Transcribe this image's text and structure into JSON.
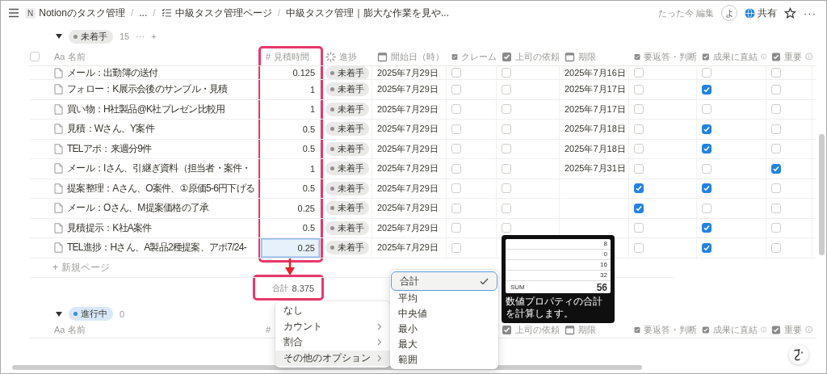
{
  "breadcrumb": [
    {
      "kind": "workspace",
      "glyph": "N",
      "label": "Notionのタスク管理"
    },
    {
      "kind": "ellipsis",
      "separator": "/",
      "label": "..."
    },
    {
      "kind": "list",
      "separator": "/",
      "label": "中級タスク管理ページ"
    },
    {
      "kind": "page",
      "separator": "/",
      "label": "中級タスク管理｜膨大な作業を見や..."
    }
  ],
  "topbar": {
    "edited": "たった今 編集",
    "avatar": "よ",
    "share": "共有",
    "more": "···"
  },
  "groups": [
    {
      "label": "未着手",
      "color": "#91918e",
      "count": "15",
      "more": "···",
      "add": "+",
      "expanded": true,
      "select_all_checked": false,
      "columns": [
        {
          "kind": "title",
          "glyph": "Aa",
          "label": "名前"
        },
        {
          "kind": "number",
          "glyph": "#",
          "label": "見積時間"
        },
        {
          "kind": "status",
          "label": "進捗"
        },
        {
          "kind": "date",
          "label": "開始日（時）"
        },
        {
          "kind": "checkbox",
          "label": "クレーム"
        },
        {
          "kind": "checkbox",
          "label": "上司の依頼"
        },
        {
          "kind": "date",
          "label": "期限"
        },
        {
          "kind": "checkbox",
          "label": "要返答・判断"
        },
        {
          "kind": "checkbox",
          "label": "成果に直結",
          "info": true
        },
        {
          "kind": "checkbox",
          "label": "重要",
          "info": true
        }
      ],
      "rows": [
        {
          "estimate_selected": false,
          "cells": [
            "メール：出勤簿の送付",
            "0.125",
            "未着手",
            "2025年7月29日",
            false,
            false,
            "2025年7月16日",
            false,
            false,
            false
          ]
        },
        {
          "estimate_selected": false,
          "cells": [
            "フォロー：K展示会後のサンプル・見積",
            "1",
            "未着手",
            "2025年7月29日",
            false,
            false,
            "2025年7月17日",
            false,
            true,
            false
          ]
        },
        {
          "estimate_selected": false,
          "cells": [
            "買い物：H社製品@K社プレゼン比較用",
            "1",
            "未着手",
            "2025年7月29日",
            false,
            false,
            "2025年7月17日",
            false,
            false,
            false
          ]
        },
        {
          "estimate_selected": false,
          "cells": [
            "見積：Wさん、Y案件",
            "0.5",
            "未着手",
            "2025年7月29日",
            false,
            false,
            "2025年7月18日",
            false,
            true,
            false
          ]
        },
        {
          "estimate_selected": false,
          "cells": [
            "TELアポ：来週分9件",
            "0.5",
            "未着手",
            "2025年7月29日",
            false,
            false,
            "2025年7月18日",
            false,
            true,
            false
          ]
        },
        {
          "estimate_selected": false,
          "cells": [
            "メール：Iさん、引継ぎ資料（担当者・案件・",
            "1",
            "未着手",
            "2025年7月29日",
            false,
            false,
            "2025年7月31日",
            false,
            false,
            true
          ]
        },
        {
          "estimate_selected": false,
          "cells": [
            "提案整理：Aさん、O案件、①原価5-6円下げる",
            "0.5",
            "未着手",
            "2025年7月29日",
            false,
            false,
            "",
            true,
            true,
            false
          ]
        },
        {
          "estimate_selected": false,
          "cells": [
            "メール：Oさん、M提案価格の了承",
            "0.25",
            "未着手",
            "2025年7月29日",
            false,
            false,
            "",
            true,
            false,
            false
          ]
        },
        {
          "estimate_selected": false,
          "cells": [
            "見積提示：K社A案件",
            "0.5",
            "未着手",
            "2025年7月29日",
            false,
            false,
            "",
            false,
            true,
            false
          ]
        },
        {
          "estimate_selected": true,
          "cells": [
            "TEL進捗：Hさん、A製品2種提案、アポ7/24-",
            "0.25",
            "未着手",
            "2025年7月29日",
            false,
            null,
            "",
            false,
            true,
            false
          ]
        }
      ],
      "new_page_icon": "+",
      "new_page": "新規ページ",
      "sum": {
        "label": "合計",
        "value": "8.375"
      }
    },
    {
      "label": "進行中",
      "color": "#3a8ed6",
      "count": "0",
      "expanded": true,
      "columns": [
        {
          "kind": "title",
          "glyph": "Aa",
          "label": "名前"
        },
        {
          "kind": "number",
          "glyph": "#"
        },
        {
          "kind": "checkbox",
          "label": "上司の依頼"
        },
        {
          "kind": "date",
          "label": "期限"
        },
        {
          "kind": "checkbox",
          "label": "要返答・判断"
        },
        {
          "kind": "checkbox",
          "label": "成果に直結",
          "info": true
        },
        {
          "kind": "checkbox",
          "label": "重要",
          "info": true
        }
      ]
    }
  ],
  "calc_menu": {
    "items": [
      {
        "label": "なし",
        "submenu": false,
        "selected": false
      },
      {
        "label": "カウント",
        "submenu": true,
        "selected": false
      },
      {
        "label": "割合",
        "submenu": true,
        "selected": false
      },
      {
        "label": "その他のオプション",
        "submenu": true,
        "selected": true
      }
    ]
  },
  "submenu": {
    "items": [
      {
        "label": "合計",
        "selected": true
      },
      {
        "label": "平均",
        "selected": false
      },
      {
        "label": "中央値",
        "selected": false
      },
      {
        "label": "最小",
        "selected": false
      },
      {
        "label": "最大",
        "selected": false
      },
      {
        "label": "範囲",
        "selected": false
      }
    ]
  },
  "tooltip": {
    "rows": [
      "8",
      "0",
      "16",
      "32"
    ],
    "sum_label": "SUM",
    "sum_value": "56",
    "text": "数値プロパティの合計を計算します。"
  }
}
